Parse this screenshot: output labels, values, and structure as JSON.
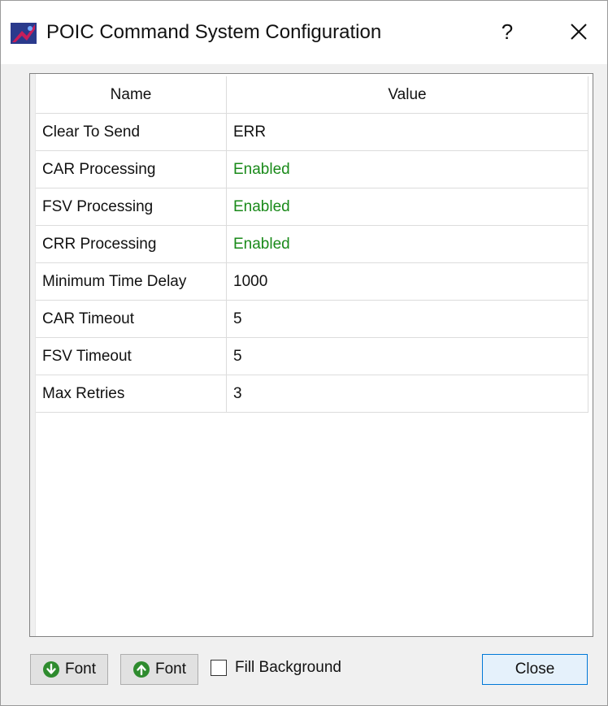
{
  "window": {
    "title": "POIC Command System Configuration",
    "help_label": "?"
  },
  "table": {
    "headers": {
      "name": "Name",
      "value": "Value"
    },
    "rows": [
      {
        "name": "Clear To Send",
        "value": "ERR",
        "status": "normal"
      },
      {
        "name": "CAR Processing",
        "value": "Enabled",
        "status": "enabled"
      },
      {
        "name": "FSV Processing",
        "value": "Enabled",
        "status": "enabled"
      },
      {
        "name": "CRR Processing",
        "value": "Enabled",
        "status": "enabled"
      },
      {
        "name": "Minimum Time Delay",
        "value": "1000",
        "status": "normal"
      },
      {
        "name": "CAR Timeout",
        "value": "5",
        "status": "normal"
      },
      {
        "name": "FSV Timeout",
        "value": "5",
        "status": "normal"
      },
      {
        "name": "Max Retries",
        "value": "3",
        "status": "normal"
      }
    ]
  },
  "footer": {
    "font_decrease_label": "Font",
    "font_increase_label": "Font",
    "fill_background_label": "Fill Background",
    "fill_background_checked": false,
    "close_label": "Close"
  },
  "colors": {
    "enabled": "#1a8a1a",
    "normal": "#111111",
    "accent": "#0078d7"
  }
}
